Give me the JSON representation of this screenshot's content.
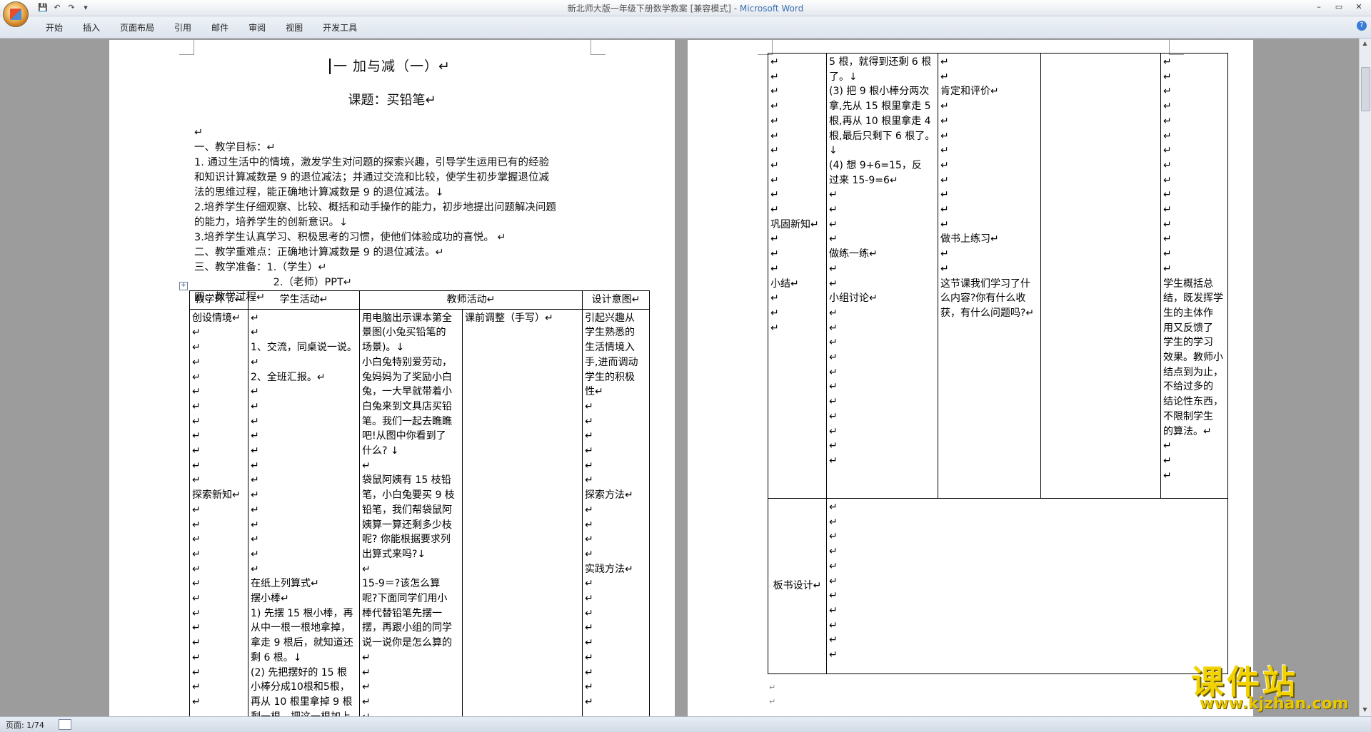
{
  "window": {
    "title": "新北师大版一年级下册数学教案 [兼容模式] - ",
    "app_name": "Microsoft Word",
    "controls": [
      "–",
      "▭",
      "✕"
    ]
  },
  "quick_access": [
    "💾",
    "↶",
    "↷",
    "▾"
  ],
  "ribbon_tabs": [
    "开始",
    "插入",
    "页面布局",
    "引用",
    "邮件",
    "审阅",
    "视图",
    "开发工具"
  ],
  "status": {
    "page": "页面: 1/74"
  },
  "page1": {
    "heading": "一  加与减（一）↵",
    "subheading": "课题：买铅笔↵",
    "lines": [
      "↵",
      "一、教学目标：↵",
      "1. 通过生活中的情境，激发学生对问题的探索兴趣，引导学生运用已有的经验",
      "和知识计算减数是 9 的退位减法；并通过交流和比较，使学生初步掌握退位减",
      "法的思维过程，能正确地计算减数是 9 的退位减法。↓",
      "2.培养学生仔细观察、比较、概括和动手操作的能力，初步地提出问题解决问题",
      "的能力，培养学生的创新意识。↓",
      "3.培养学生认真学习、积极思考的习惯，使他们体验成功的喜悦。 ↵",
      "二、教学重难点：正确地计算减数是 9 的退位减法。↵",
      "三、教学准备：1.（学生）↵",
      "                        2.（老师）PPT↵",
      "四、教学过程↵"
    ],
    "table_headers": [
      "教学环节↵",
      "学生活动↵",
      "教师活动↵",
      "",
      "设计意图↵"
    ],
    "col1": [
      "创设情境↵",
      "↵",
      "↵",
      "↵",
      "↵",
      "↵",
      "↵",
      "↵",
      "↵",
      "↵",
      "↵",
      "↵",
      "探索新知↵",
      "↵",
      "↵",
      "↵",
      "↵",
      "↵",
      "↵",
      "↵",
      "↵",
      "↵",
      "↵",
      "↵",
      "↵",
      "↵",
      "↵"
    ],
    "col2": [
      "↵",
      "↵",
      "1、交流，同桌说一说。↵",
      "2、全班汇报。↵",
      "↵",
      "↵",
      "↵",
      "↵",
      "↵",
      "↵",
      "↵",
      "↵",
      "↵",
      "↵",
      "↵",
      "↵",
      "↵",
      "在纸上列算式↵",
      "摆小棒↵",
      "1) 先摆 15 根小棒，再",
      "从中一根一根地拿掉，",
      "拿走 9 根后，就知道还",
      "剩 6 根。↓",
      "(2) 先把摆好的 15 根",
      "小棒分成10根和5根，",
      "再从 10 根里拿掉 9 根",
      "剩一根，把这一根加上"
    ],
    "col3": [
      "用电脑出示课本第全",
      "景图(小兔买铅笔的",
      "场景)。↓",
      "小白兔特别爱劳动，",
      "兔妈妈为了奖励小白",
      "兔，一大早就带着小",
      "白兔来到文具店买铅",
      "笔。我们一起去瞧瞧",
      "吧!从图中你看到了",
      "什么? ↓",
      "↵",
      "袋鼠阿姨有 15 枝铅",
      "笔，小白兔要买 9 枝",
      "铅笔，我们帮袋鼠阿",
      "姨算一算还剩多少枝",
      "呢? 你能根据要求列",
      "出算式来吗?↓",
      "↵",
      "15-9＝?该怎么算",
      "呢?下面同学们用小",
      "棒代替铅笔先摆一",
      "摆，再跟小组的同学",
      "说一说你是怎么算的↵",
      "↵",
      "↵",
      "↵",
      "↵"
    ],
    "col4": [
      "课前调整（手写）↵"
    ],
    "col5": [
      "引起兴趣从",
      "学生熟悉的",
      "生活情境入",
      "手,进而调动",
      "学生的积极",
      "性↵",
      "↵",
      "↵",
      "↵",
      "↵",
      "↵",
      "↵",
      "探索方法↵",
      "↵",
      "↵",
      "↵",
      "↵",
      "实践方法↵",
      "↵",
      "↵",
      "↵",
      "↵",
      "↵",
      "↵",
      "↵",
      "↵",
      "↵"
    ]
  },
  "page2": {
    "col1": [
      "↵",
      "↵",
      "↵",
      "↵",
      "↵",
      "↵",
      "↵",
      "↵",
      "↵",
      "↵",
      "↵",
      "巩固新知↵",
      "↵",
      "↵",
      "↵",
      "小结↵",
      "↵",
      "↵",
      "↵"
    ],
    "col2": [
      "5 根，就得到还剩 6 根",
      "了。↓",
      "(3) 把 9 根小棒分两次",
      "拿,先从 15 根里拿走 5",
      "根,再从 10 根里拿走 4",
      "根,最后只剩下 6 根了。↓",
      "(4) 想 9+6=15，反",
      "过来 15-9=6↵",
      "↵",
      "↵",
      "↵",
      "↵",
      "做练一练↵",
      "↵",
      "↵",
      "小组讨论↵",
      "↵",
      "↵",
      "↵",
      "↵",
      "↵",
      "↵",
      "↵",
      "↵",
      "↵",
      "↵",
      "↵"
    ],
    "col3": [
      "↵",
      "↵",
      "肯定和评价↵",
      "↵",
      "↵",
      "↵",
      "↵",
      "↵",
      "↵",
      "↵",
      "↵",
      "↵",
      "做书上练习↵",
      "↵",
      "↵",
      "这节课我们学习了什",
      "么内容?你有什么收",
      "获，有什么问题吗?↵"
    ],
    "col4": [
      ""
    ],
    "col5": [
      "↵",
      "↵",
      "↵",
      "↵",
      "↵",
      "↵",
      "↵",
      "↵",
      "↵",
      "↵",
      "↵",
      "↵",
      "↵",
      "↵",
      "↵",
      "学生概括总",
      "结，既发挥学",
      "生的主体作",
      "用又反馈了",
      "学生的学习",
      "效果。教师小",
      "结点到为止，",
      "不给过多的",
      "结论性东西，",
      "不限制学生",
      "的算法。↵",
      "↵",
      "↵",
      "↵"
    ],
    "board_label": "板书设计↵",
    "board_lines": [
      "↵",
      "↵",
      "↵",
      "↵",
      "↵",
      "↵",
      "↵",
      "↵",
      "↵",
      "↵",
      "↵"
    ],
    "after_lines": [
      "↵",
      "↵"
    ]
  },
  "watermark": {
    "text": "课件站",
    "url": "www.kjzhan.com"
  }
}
